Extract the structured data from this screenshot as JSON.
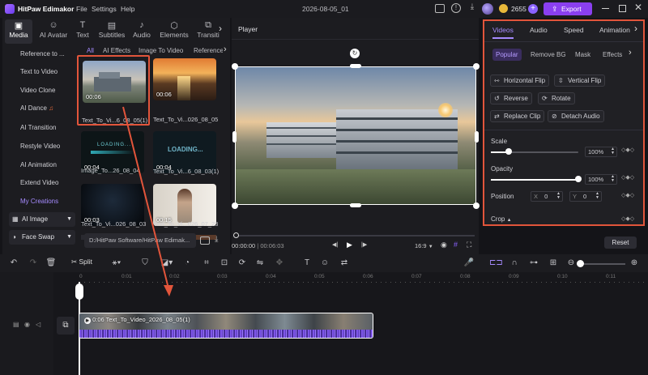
{
  "titlebar": {
    "app_name": "HitPaw Edimakor",
    "menus": [
      "File",
      "Settings",
      "Help"
    ],
    "project_title": "2026-08-05_01",
    "credits": "2655",
    "export_label": "Export"
  },
  "category_tabs": [
    {
      "label": "Media",
      "icon": "media-icon",
      "active": true
    },
    {
      "label": "AI Avatar",
      "icon": "avatar-icon"
    },
    {
      "label": "Text",
      "icon": "text-icon"
    },
    {
      "label": "Subtitles",
      "icon": "subtitles-icon"
    },
    {
      "label": "Audio",
      "icon": "audio-icon"
    },
    {
      "label": "Elements",
      "icon": "elements-icon"
    },
    {
      "label": "Transiti",
      "icon": "transition-icon"
    }
  ],
  "sidebar": {
    "items": [
      "Reference to ...",
      "Text to Video",
      "Video Clone",
      "AI Dance",
      "AI Transition",
      "Restyle Video",
      "AI Animation",
      "Extend Video",
      "My Creations"
    ],
    "dropdowns": [
      "AI Image",
      "Face Swap"
    ]
  },
  "media_filters": [
    "All",
    "AI Effects",
    "Image To Video",
    "Reference"
  ],
  "media_items": [
    {
      "duration": "00:06",
      "name": "Text_To_Vi...6_08_05(1)",
      "style": "building",
      "selected": true
    },
    {
      "duration": "00:06",
      "name": "Text_To_Vi...026_08_05",
      "style": "sunset"
    },
    {
      "duration": "00:04",
      "name": "Image_To...26_08_04",
      "style": "loading1",
      "overlay": "LOADING..."
    },
    {
      "duration": "00:04",
      "name": "Text_To_Vi...6_08_03(1)",
      "style": "loading2",
      "overlay": "LOADING..."
    },
    {
      "duration": "00:03",
      "name": "Text_To_Vi...026_08_03",
      "style": "dark"
    },
    {
      "duration": "00:15",
      "name": "Text_To_Vi...026_07_23",
      "style": "person"
    }
  ],
  "path_field": "D:/HitPaw Software/HitPaw Edimak...",
  "player": {
    "title": "Player",
    "current_time": "00:00:00",
    "total_time": "00:06:03",
    "aspect_ratio": "16:9"
  },
  "props": {
    "tabs": [
      "Videos",
      "Audio",
      "Speed",
      "Animation"
    ],
    "subtabs": [
      "Popular",
      "Remove BG",
      "Mask",
      "Effects"
    ],
    "buttons": [
      "Horizontal Flip",
      "Vertical Flip",
      "Reverse",
      "Rotate",
      "Replace Clip",
      "Detach Audio"
    ],
    "scale_label": "Scale",
    "scale_value": "100%",
    "scale_level": 0.2,
    "opacity_label": "Opacity",
    "opacity_value": "100%",
    "opacity_level": 1.0,
    "position_label": "Position",
    "pos_x_label": "X",
    "pos_x": "0",
    "pos_y_label": "Y",
    "pos_y": "0",
    "crop_label": "Crop",
    "reset_label": "Reset"
  },
  "toolbar": {
    "split_label": "Split"
  },
  "timeline": {
    "ticks": [
      "0",
      "0:01",
      "0:02",
      "0:03",
      "0:04",
      "0:05",
      "0:06",
      "0:07",
      "0:08",
      "0:09",
      "0:10",
      "0:11"
    ],
    "clip_label": "0:06 Text_To_Video_2026_08_05(1)"
  },
  "colors": {
    "accent": "#8a62ff",
    "highlight_border": "#e2553b",
    "export_bg": "#8a3ff0"
  }
}
